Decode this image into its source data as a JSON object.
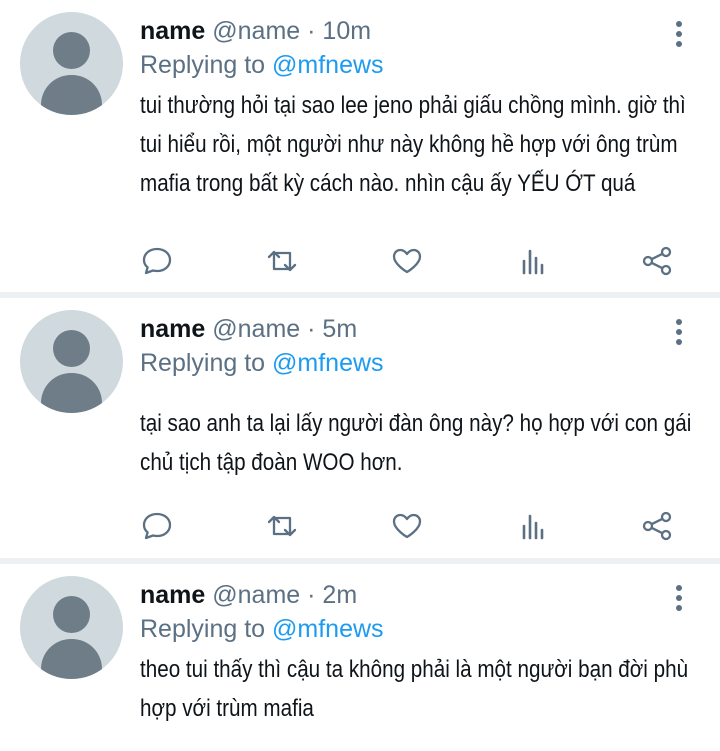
{
  "tweets": [
    {
      "name": "name",
      "handle": "@name",
      "time": "10m",
      "replying_prefix": "Replying to",
      "replying_handle": "@mfnews",
      "text": "tui thường hỏi tại sao lee jeno phải giấu chồng mình. giờ thì tui hiểu rồi, một người như này không hề hợp với ông trùm mafia trong bất kỳ cách nào. nhìn cậu ấy YẾU ỚT quá"
    },
    {
      "name": "name",
      "handle": "@name",
      "time": "5m",
      "replying_prefix": "Replying to",
      "replying_handle": "@mfnews",
      "text": "tại sao anh ta lại lấy người đàn ông này? họ hợp với con gái chủ tịch tập đoàn WOO hơn."
    },
    {
      "name": "name",
      "handle": "@name",
      "time": "2m",
      "replying_prefix": "Replying to",
      "replying_handle": "@mfnews",
      "text": "theo tui thấy thì cậu ta không phải là một người bạn đời phù hợp với trùm mafia"
    }
  ],
  "icons": {
    "reply": "reply-icon",
    "retweet": "retweet-icon",
    "like": "heart-icon",
    "analytics": "analytics-icon",
    "share": "share-icon",
    "more": "more-vertical-icon"
  },
  "colors": {
    "name": "#0f1419",
    "meta": "#5b7083",
    "link": "#1d9bf0",
    "avatar_bg": "#cfd9de",
    "avatar_fg": "#6e7d88",
    "divider": "#eef1f4"
  }
}
